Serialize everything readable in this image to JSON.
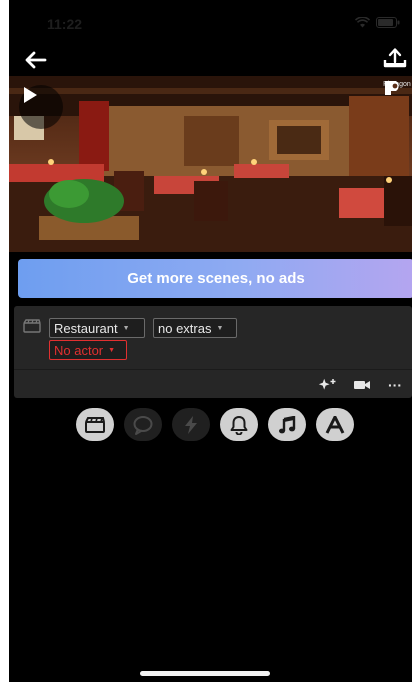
{
  "status_bar": {
    "time": "11:22"
  },
  "scene_preview": {
    "logo_text": "Plotagon"
  },
  "promo": {
    "label": "Get more scenes, no ads"
  },
  "scene_card": {
    "location": "Restaurant",
    "extras": "no extras",
    "actor": "No actor",
    "more_label": "···"
  },
  "toolbar": {
    "items": [
      "scene",
      "speech",
      "action",
      "sound-effect",
      "music",
      "text"
    ]
  },
  "colors": {
    "promo_start": "#6e9ef0",
    "promo_end": "#b4a5f0",
    "warning": "#e13030",
    "card_bg": "#262626"
  }
}
